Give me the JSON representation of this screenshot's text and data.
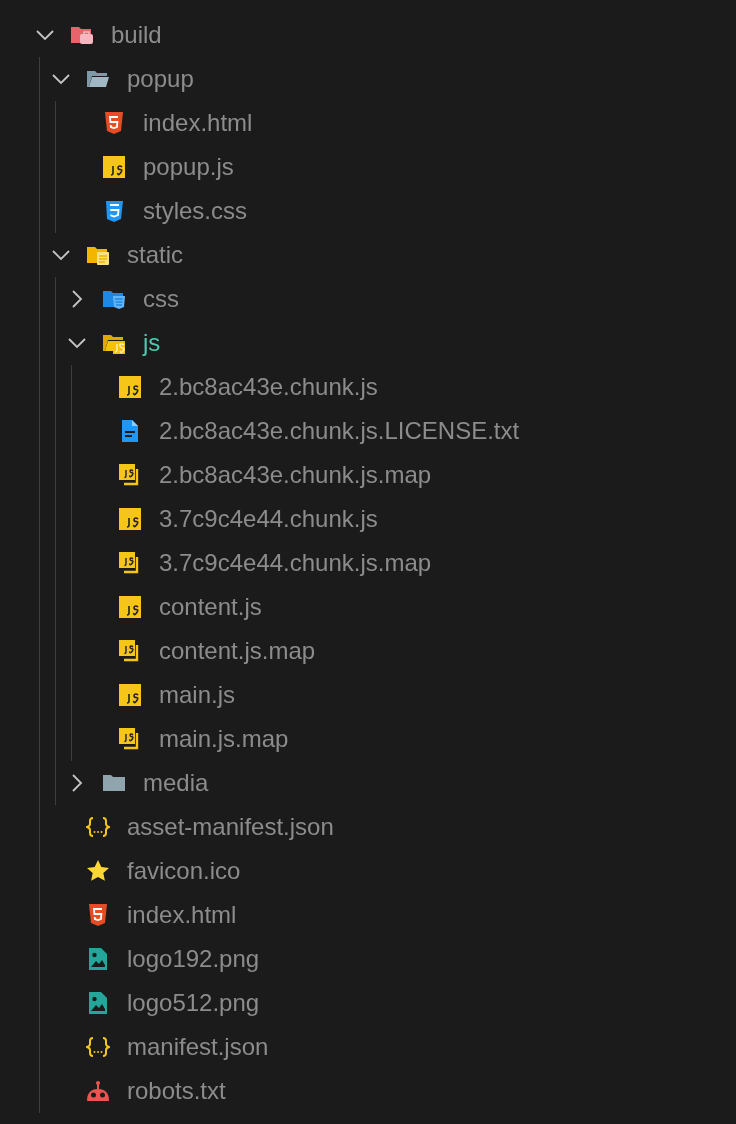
{
  "explorer": {
    "tree": [
      {
        "name": "build",
        "kind": "folder-build",
        "expanded": true,
        "highlighted": false,
        "children": [
          {
            "name": "popup",
            "kind": "folder-plain",
            "expanded": true,
            "highlighted": false,
            "children": [
              {
                "name": "index.html",
                "kind": "html",
                "highlighted": false
              },
              {
                "name": "popup.js",
                "kind": "js",
                "highlighted": false
              },
              {
                "name": "styles.css",
                "kind": "css",
                "highlighted": false
              }
            ]
          },
          {
            "name": "static",
            "kind": "folder-static",
            "expanded": true,
            "highlighted": false,
            "children": [
              {
                "name": "css",
                "kind": "folder-css",
                "expanded": false,
                "highlighted": false
              },
              {
                "name": "js",
                "kind": "folder-js",
                "expanded": true,
                "highlighted": true,
                "children": [
                  {
                    "name": "2.bc8ac43e.chunk.js",
                    "kind": "js",
                    "highlighted": false
                  },
                  {
                    "name": "2.bc8ac43e.chunk.js.LICENSE.txt",
                    "kind": "text",
                    "highlighted": false
                  },
                  {
                    "name": "2.bc8ac43e.chunk.js.map",
                    "kind": "jsmap",
                    "highlighted": false
                  },
                  {
                    "name": "3.7c9c4e44.chunk.js",
                    "kind": "js",
                    "highlighted": false
                  },
                  {
                    "name": "3.7c9c4e44.chunk.js.map",
                    "kind": "jsmap",
                    "highlighted": false
                  },
                  {
                    "name": "content.js",
                    "kind": "js",
                    "highlighted": false
                  },
                  {
                    "name": "content.js.map",
                    "kind": "jsmap",
                    "highlighted": false
                  },
                  {
                    "name": "main.js",
                    "kind": "js",
                    "highlighted": false
                  },
                  {
                    "name": "main.js.map",
                    "kind": "jsmap",
                    "highlighted": false
                  }
                ]
              },
              {
                "name": "media",
                "kind": "folder-media",
                "expanded": false,
                "highlighted": false
              }
            ]
          },
          {
            "name": "asset-manifest.json",
            "kind": "json",
            "highlighted": false
          },
          {
            "name": "favicon.ico",
            "kind": "star",
            "highlighted": false
          },
          {
            "name": "index.html",
            "kind": "html",
            "highlighted": false
          },
          {
            "name": "logo192.png",
            "kind": "image",
            "highlighted": false
          },
          {
            "name": "logo512.png",
            "kind": "image",
            "highlighted": false
          },
          {
            "name": "manifest.json",
            "kind": "json",
            "highlighted": false
          },
          {
            "name": "robots.txt",
            "kind": "robot",
            "highlighted": false
          }
        ]
      }
    ]
  }
}
